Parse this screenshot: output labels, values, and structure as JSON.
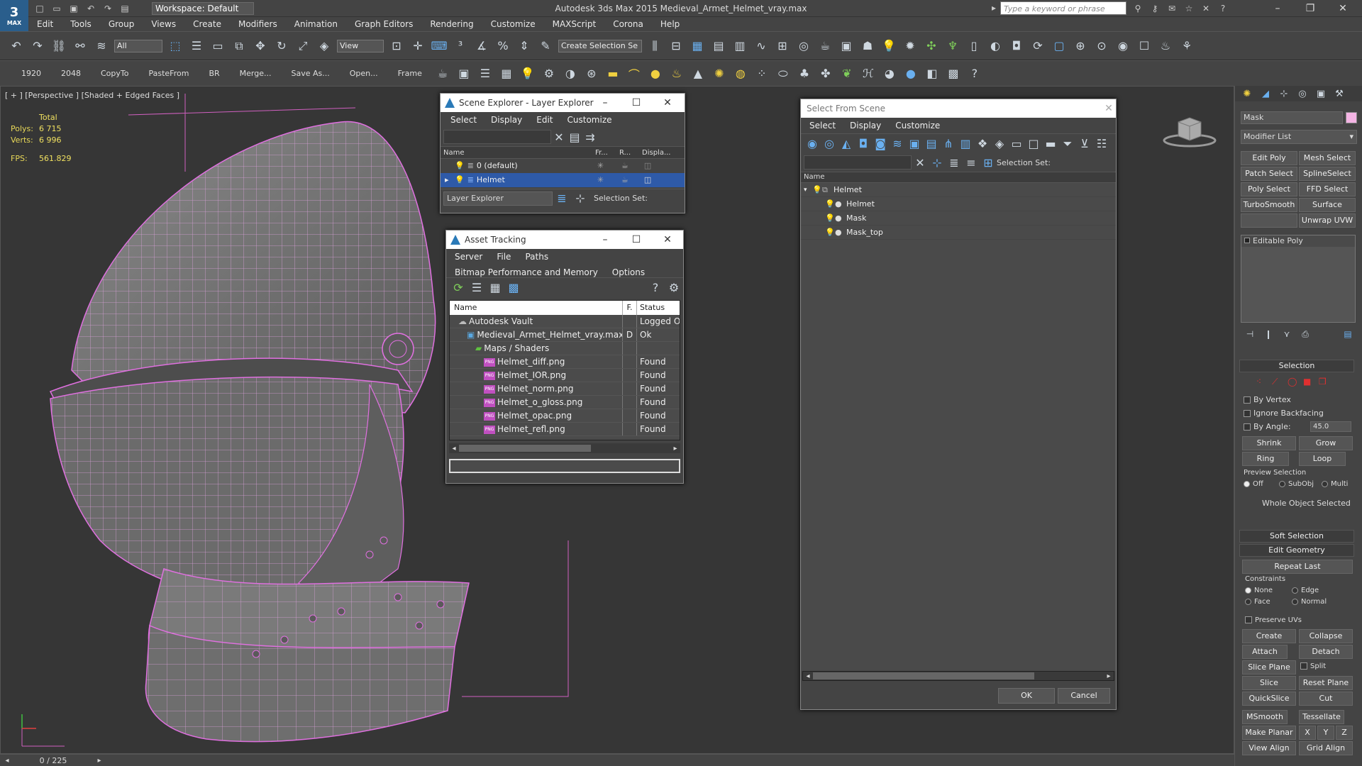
{
  "app": {
    "title": "Autodesk 3ds Max  2015    Medieval_Armet_Helmet_vray.max",
    "logo": "MAX",
    "workspace": "Workspace: Default",
    "search_placeholder": "Type a keyword or phrase"
  },
  "menu": [
    "Edit",
    "Tools",
    "Group",
    "Views",
    "Create",
    "Modifiers",
    "Animation",
    "Graph Editors",
    "Rendering",
    "Customize",
    "MAXScript",
    "Corona",
    "Help"
  ],
  "toolbar1": {
    "selection_filter": "All",
    "ref_coord": "View",
    "named_selection": "Create Selection Se"
  },
  "toolbar2": {
    "items": [
      "1920",
      "2048",
      "CopyTo",
      "PasteFrom",
      "BR",
      "Merge...",
      "Save As...",
      "Open...",
      "Frame"
    ]
  },
  "viewport": {
    "label": "[ + ] [Perspective ] [Shaded + Edged Faces ]",
    "stats": {
      "total_label": "Total",
      "polys_label": "Polys:",
      "polys": "6 715",
      "verts_label": "Verts:",
      "verts": "6 996",
      "fps_label": "FPS:",
      "fps": "561.829"
    }
  },
  "scene_explorer": {
    "title": "Scene Explorer - Layer Explorer",
    "menu": [
      "Select",
      "Display",
      "Edit",
      "Customize"
    ],
    "columns": [
      "Name",
      "Fr...",
      "R...",
      "Displa..."
    ],
    "rows": [
      {
        "name": "0 (default)"
      },
      {
        "name": "Helmet"
      }
    ],
    "mode": "Layer Explorer",
    "selection_set_label": "Selection Set:"
  },
  "asset_tracking": {
    "title": "Asset Tracking",
    "menu": [
      "Server",
      "File",
      "Paths",
      "Bitmap Performance and Memory",
      "Options"
    ],
    "columns": [
      "Name",
      "F.",
      "Status"
    ],
    "rows": [
      {
        "name": "Autodesk Vault",
        "f": "",
        "status": "Logged Ou",
        "indent": 1,
        "type": "vault"
      },
      {
        "name": "Medieval_Armet_Helmet_vray.max",
        "f": "D",
        "status": "Ok",
        "indent": 2,
        "type": "max"
      },
      {
        "name": "Maps / Shaders",
        "f": "",
        "status": "",
        "indent": 3,
        "type": "folder"
      },
      {
        "name": "Helmet_diff.png",
        "f": "",
        "status": "Found",
        "indent": 4,
        "type": "png"
      },
      {
        "name": "Helmet_IOR.png",
        "f": "",
        "status": "Found",
        "indent": 4,
        "type": "png"
      },
      {
        "name": "Helmet_norm.png",
        "f": "",
        "status": "Found",
        "indent": 4,
        "type": "png"
      },
      {
        "name": "Helmet_o_gloss.png",
        "f": "",
        "status": "Found",
        "indent": 4,
        "type": "png"
      },
      {
        "name": "Helmet_opac.png",
        "f": "",
        "status": "Found",
        "indent": 4,
        "type": "png"
      },
      {
        "name": "Helmet_refl.png",
        "f": "",
        "status": "Found",
        "indent": 4,
        "type": "png"
      }
    ],
    "png_badge": "PNG"
  },
  "select_from_scene": {
    "title": "Select From Scene",
    "menu": [
      "Select",
      "Display",
      "Customize"
    ],
    "selection_set_label": "Selection Set:",
    "column": "Name",
    "rows": [
      {
        "name": "Helmet",
        "indent": 0
      },
      {
        "name": "Helmet",
        "indent": 1
      },
      {
        "name": "Mask",
        "indent": 1
      },
      {
        "name": "Mask_top",
        "indent": 1
      }
    ],
    "ok": "OK",
    "cancel": "Cancel"
  },
  "command_panel": {
    "object_name": "Mask",
    "object_color": "#f4b4e4",
    "modifier_list": "Modifier List",
    "modifier_buttons": [
      "Edit Poly",
      "Mesh Select",
      "Patch Select",
      "SplineSelect",
      "Poly Select",
      "FFD Select",
      "TurboSmooth",
      "Surface Select",
      "",
      "Unwrap UVW"
    ],
    "stack_item": "Editable Poly",
    "selection": {
      "title": "Selection",
      "by_vertex": "By Vertex",
      "ignore_backfacing": "Ignore Backfacing",
      "by_angle": "By Angle:",
      "angle": "45.0",
      "shrink": "Shrink",
      "grow": "Grow",
      "ring": "Ring",
      "loop": "Loop",
      "preview": "Preview Selection",
      "off": "Off",
      "subobj": "SubObj",
      "multi": "Multi",
      "status": "Whole Object Selected"
    },
    "soft_selection": "Soft Selection",
    "edit_geometry": {
      "title": "Edit Geometry",
      "repeat_last": "Repeat Last",
      "constraints": "Constraints",
      "none": "None",
      "edge": "Edge",
      "face": "Face",
      "normal": "Normal",
      "preserve_uvs": "Preserve UVs",
      "create": "Create",
      "collapse": "Collapse",
      "attach": "Attach",
      "detach": "Detach",
      "slice_plane": "Slice Plane",
      "split": "Split",
      "slice": "Slice",
      "reset_plane": "Reset Plane",
      "quickslice": "QuickSlice",
      "cut": "Cut",
      "msmooth": "MSmooth",
      "tessellate": "Tessellate",
      "make_planar": "Make Planar",
      "x": "X",
      "y": "Y",
      "z": "Z",
      "view_align": "View Align",
      "grid_align": "Grid Align"
    }
  },
  "status": {
    "frame": "0 / 225"
  },
  "colors": {
    "wire": "#e070e0",
    "selected_row": "#2e5aa8",
    "accent": "#2a7ab8"
  }
}
